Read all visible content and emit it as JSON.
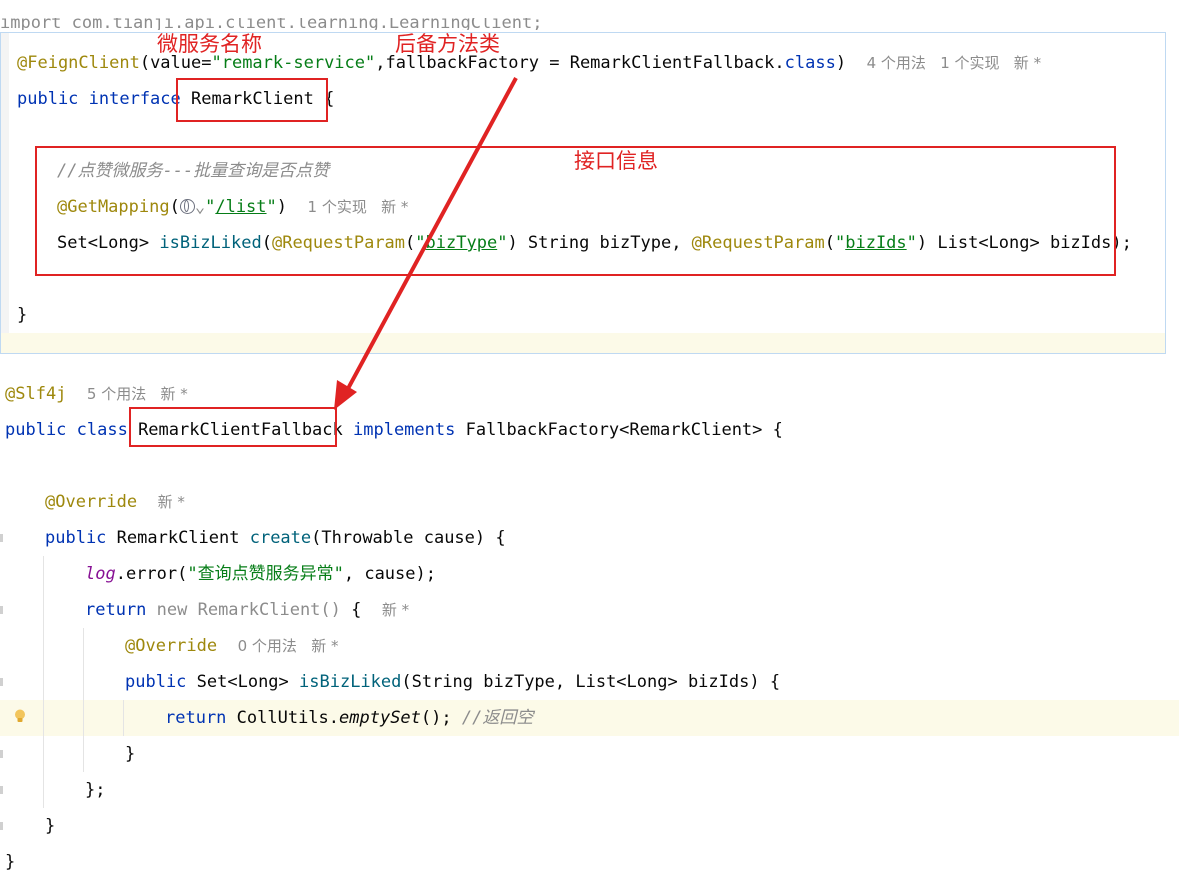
{
  "cut_top_text": "import com.tianji.api.client.learning.LearningClient;",
  "labels": {
    "service_name": "微服务名称",
    "fallback_class": "后备方法类",
    "interface_info": "接口信息"
  },
  "popup": {
    "l1": {
      "ann": "@FeignClient",
      "p1": "(value=",
      "s1": "\"remark-service\"",
      "p2": ",fallbackFactory = RemarkClientFallback.",
      "kw": "class",
      "p3": ")",
      "hint": "4 个用法   1 个实现   新 *"
    },
    "l2": {
      "kw": "public interface ",
      "name": "RemarkClient",
      "p": " {"
    },
    "l3": {
      "cmt": "//点赞微服务---批量查询是否点赞"
    },
    "l4": {
      "ann": "@GetMapping",
      "p1": "(",
      "s_q1": "\"",
      "s_path": "/list",
      "s_q2": "\"",
      "p2": ")",
      "hint": "1 个实现   新 *"
    },
    "l5": {
      "t1": "Set<Long> ",
      "fn": "isBizLiked",
      "p1": "(",
      "a1": "@RequestParam",
      "p2": "(",
      "s1a": "\"",
      "s1b": "bizType",
      "s1c": "\"",
      "p3": ") String bizType, ",
      "a2": "@RequestParam",
      "p4": "(",
      "s2a": "\"",
      "s2b": "bizIds",
      "s2c": "\"",
      "p5": ") List<Long> bizIds);"
    },
    "l6": {
      "p": "}"
    }
  },
  "main": {
    "l1": {
      "ann": "@Slf4j",
      "hint": "5 个用法   新 *"
    },
    "l2": {
      "kw1": "public class ",
      "name": "RemarkClientFallback",
      "kw2": " implements ",
      "p": "FallbackFactory<RemarkClient> {"
    },
    "l3": {
      "ann": "@Override",
      "hint": "新 *"
    },
    "l4": {
      "kw": "public ",
      "t": "RemarkClient ",
      "fn": "create",
      "p": "(Throwable cause) {"
    },
    "l5": {
      "log": "log",
      "p1": ".error(",
      "s": "\"查询点赞服务异常\"",
      "p2": ", cause);"
    },
    "l6": {
      "kw": "return ",
      "gray": "new RemarkClient()",
      "p": " {",
      "hint": "新 *"
    },
    "l7": {
      "ann": "@Override",
      "hint": "0 个用法   新 *"
    },
    "l8": {
      "kw": "public ",
      "t": "Set<Long> ",
      "fn": "isBizLiked",
      "p": "(String bizType, List<Long> bizIds) {"
    },
    "l9": {
      "kw": "return ",
      "t": "CollUtils.",
      "it": "emptySet",
      "p": "(); ",
      "cmt": "//返回空"
    },
    "l10": {
      "p": "}"
    },
    "l11": {
      "p": "};"
    },
    "l12": {
      "p": "}"
    },
    "l13": {
      "p": "}"
    }
  }
}
